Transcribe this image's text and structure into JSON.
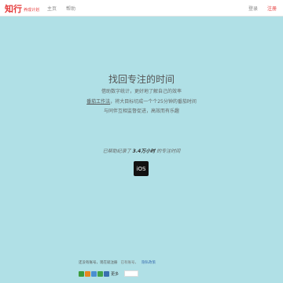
{
  "header": {
    "logo_text": "知行",
    "logo_sub": "养成计划",
    "nav": [
      {
        "label": "主页"
      },
      {
        "label": "帮助"
      }
    ],
    "login_label": "登录",
    "register_label": "注册"
  },
  "hero": {
    "title": "找回专注的时间",
    "line1": "借助数字统计，更好地了解自己的效率",
    "line2_link": "番茄工作法",
    "line2_rest": "，将大目标切成一个个25分钟的番茄时间",
    "line3": "与同伴互相监督促进，高效而有乐趣"
  },
  "stat": {
    "prefix": "已帮助纪录了 ",
    "hours": "3.4万小时",
    "suffix": " 的专注时间"
  },
  "ios_button": {
    "label": "iOS"
  },
  "footer": {
    "social_text": "还没有账号，现在就注册",
    "tag_text": "已有账号，",
    "privacy_text": "隐私政策",
    "share_more": "更多"
  },
  "colors": {
    "background": "#b0e0e6",
    "brand": "#e53a3a",
    "share_icons": [
      "#3c9c3c",
      "#e8861f",
      "#4a8fd1",
      "#43a34b",
      "#3a6fb0"
    ]
  }
}
